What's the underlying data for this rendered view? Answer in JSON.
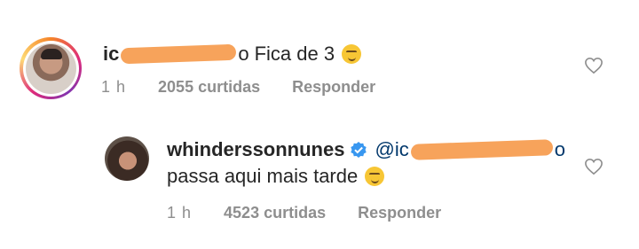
{
  "comments": [
    {
      "username_visible_prefix": "ic",
      "username_visible_suffix": "o",
      "text": "Fica de 3",
      "time": "1 h",
      "likes": "2055 curtidas",
      "reply_label": "Responder"
    },
    {
      "username": "whinderssonnunes",
      "mention_visible_prefix": "@ic",
      "mention_visible_suffix": "o",
      "text": "passa aqui mais tarde",
      "time": "1 h",
      "likes": "4523 curtidas",
      "reply_label": "Responder"
    }
  ],
  "icons": {
    "like": "heart-icon",
    "verified": "verified-badge-icon",
    "emoji": "smirking-face-emoji"
  },
  "colors": {
    "verified_blue": "#3897f0",
    "mention": "#00376b",
    "meta_gray": "#8e8e8e",
    "redaction": "#f7a35b"
  }
}
